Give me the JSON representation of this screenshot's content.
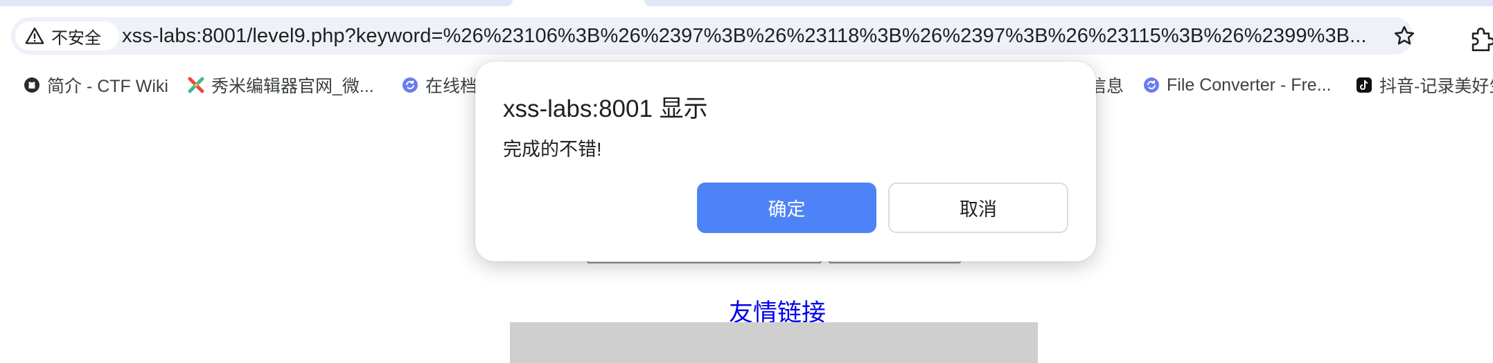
{
  "browser": {
    "security_label": "不安全",
    "url": "xss-labs:8001/level9.php?keyword=%26%23106%3B%26%2397%3B%26%23118%3B%26%2397%3B%26%23115%3B%26%2399%3B..."
  },
  "bookmarks": [
    {
      "label": "简介 - CTF Wiki",
      "icon": "github-icon"
    },
    {
      "label": "秀米编辑器官网_微...",
      "icon": "xiumi-icon"
    },
    {
      "label": "在线档",
      "icon": "sync-icon"
    },
    {
      "label": "信息",
      "icon": "none"
    },
    {
      "label": "File Converter - Fre...",
      "icon": "sync-icon"
    },
    {
      "label": "抖音-记录美好生",
      "icon": "tiktok-icon"
    }
  ],
  "page": {
    "friend_link": "友情链接"
  },
  "dialog": {
    "title": "xss-labs:8001 显示",
    "message": "完成的不错!",
    "ok_label": "确定",
    "cancel_label": "取消"
  },
  "colors": {
    "accent": "#4d83f6",
    "link": "#0000ee",
    "omnibox_bg": "#eef1f7"
  }
}
